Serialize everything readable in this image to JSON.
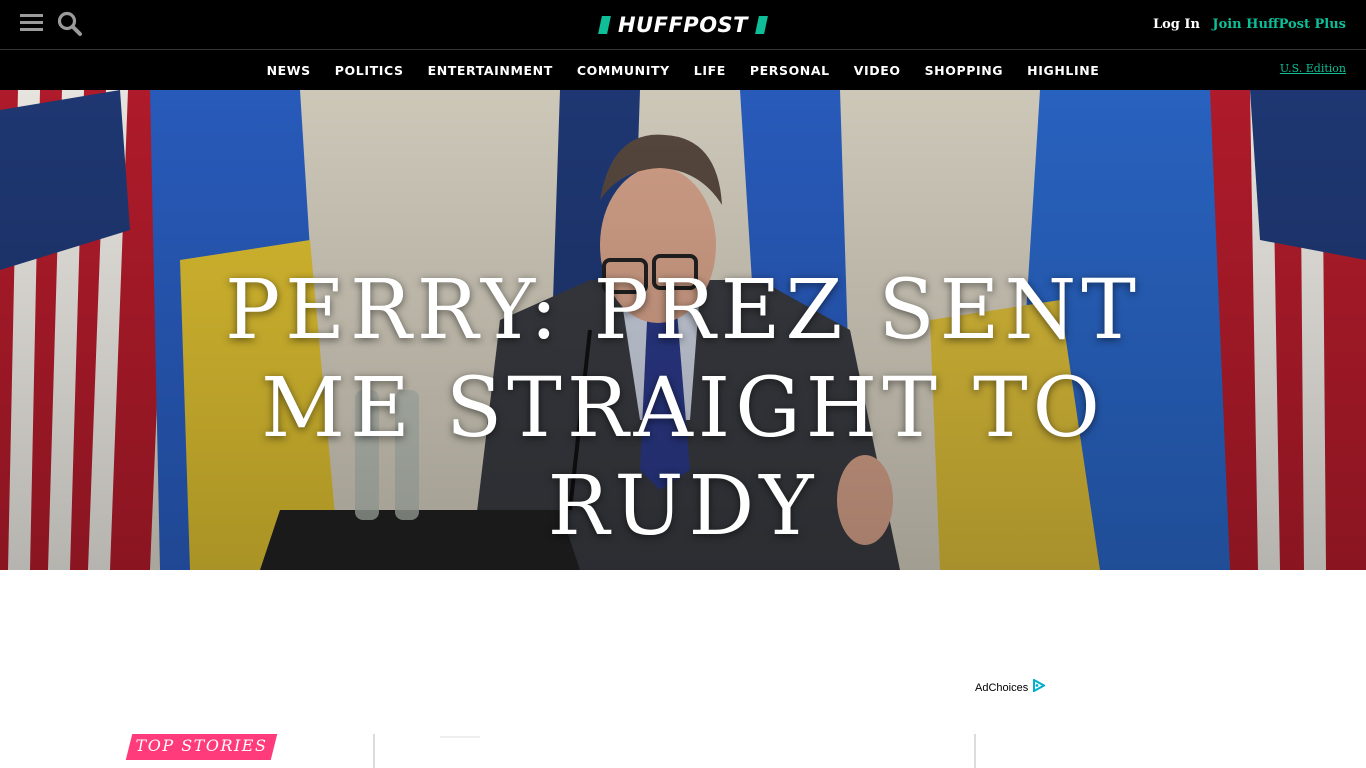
{
  "header": {
    "logo_text": "HUFFPOST",
    "login_label": "Log In",
    "join_label": "Join HuffPost Plus",
    "menu_icon": "hamburger-icon",
    "search_icon": "search-icon"
  },
  "nav": {
    "items": [
      "NEWS",
      "POLITICS",
      "ENTERTAINMENT",
      "COMMUNITY",
      "LIFE",
      "PERSONAL",
      "VIDEO",
      "SHOPPING",
      "HIGHLINE"
    ],
    "edition_label": "U.S. Edition"
  },
  "hero": {
    "headline": "PERRY: PREZ SENT ME STRAIGHT TO RUDY"
  },
  "ad": {
    "adchoices_label": "AdChoices"
  },
  "top_stories": {
    "label": "TOP STORIES"
  },
  "colors": {
    "brand_green": "#0dbe98",
    "top_stories_pink": "#ff3b7b",
    "header_bg": "#000000"
  }
}
